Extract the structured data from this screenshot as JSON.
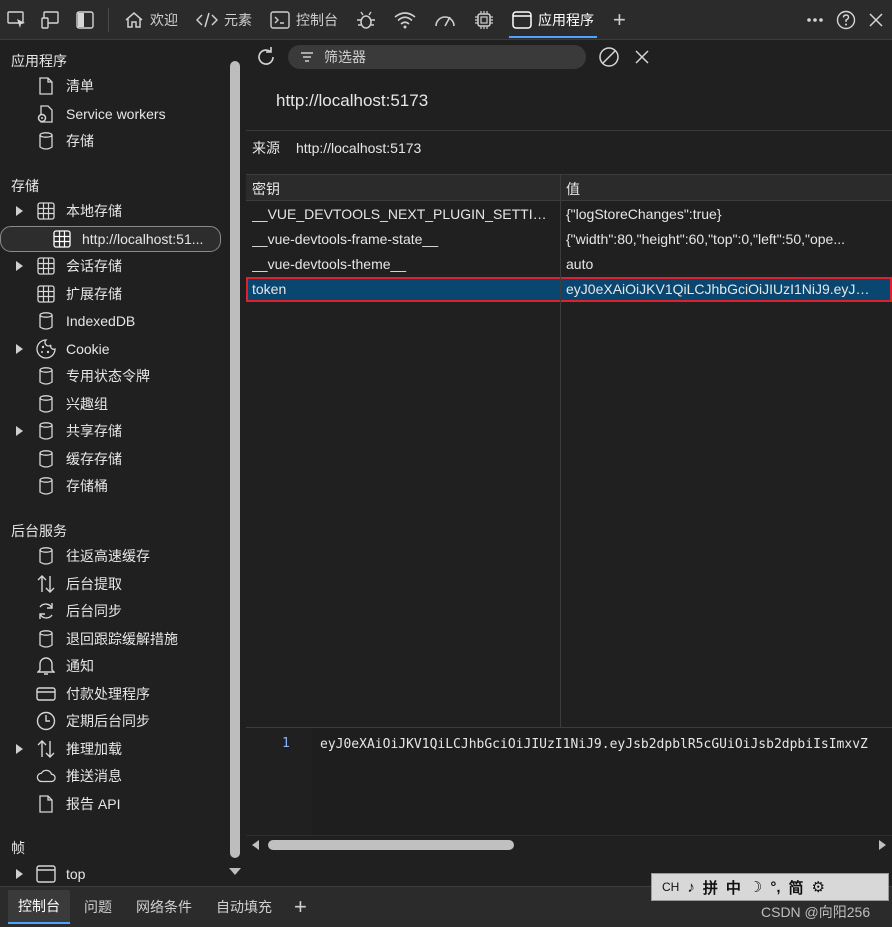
{
  "toolbar": {
    "tabs": [
      {
        "label": "欢迎",
        "icon": "home-icon"
      },
      {
        "label": "元素",
        "icon": "code-icon"
      },
      {
        "label": "控制台",
        "icon": "console-icon"
      },
      {
        "label": "",
        "icon": "bug-icon"
      },
      {
        "label": "",
        "icon": "wifi-icon"
      },
      {
        "label": "",
        "icon": "gauge-icon"
      },
      {
        "label": "",
        "icon": "chip-icon"
      },
      {
        "label": "应用程序",
        "icon": "app-window-icon"
      }
    ],
    "active_tab": "应用程序",
    "accent": "#4da3ff"
  },
  "sidebar": {
    "section_app": "应用程序",
    "app_items": [
      {
        "label": "清单",
        "icon": "file-icon"
      },
      {
        "label": "Service workers",
        "icon": "gear-file-icon"
      },
      {
        "label": "存储",
        "icon": "database-icon"
      }
    ],
    "section_storage": "存储",
    "storage_items": [
      {
        "label": "本地存储",
        "icon": "grid-icon",
        "expandable": true
      },
      {
        "label": "http://localhost:51...",
        "icon": "grid-icon",
        "selected": true
      },
      {
        "label": "会话存储",
        "icon": "grid-icon",
        "expandable": true
      },
      {
        "label": "扩展存储",
        "icon": "grid-icon"
      },
      {
        "label": "IndexedDB",
        "icon": "database-icon"
      },
      {
        "label": "Cookie",
        "icon": "cookie-icon",
        "expandable": true
      },
      {
        "label": "专用状态令牌",
        "icon": "database-icon"
      },
      {
        "label": "兴趣组",
        "icon": "database-icon"
      },
      {
        "label": "共享存储",
        "icon": "database-icon",
        "expandable": true
      },
      {
        "label": "缓存存储",
        "icon": "database-icon"
      },
      {
        "label": "存储桶",
        "icon": "database-icon"
      }
    ],
    "section_bg": "后台服务",
    "bg_items": [
      {
        "label": "往返高速缓存",
        "icon": "database-icon"
      },
      {
        "label": "后台提取",
        "icon": "updown-icon"
      },
      {
        "label": "后台同步",
        "icon": "sync-icon"
      },
      {
        "label": "退回跟踪缓解措施",
        "icon": "database-icon"
      },
      {
        "label": "通知",
        "icon": "bell-icon"
      },
      {
        "label": "付款处理程序",
        "icon": "card-icon"
      },
      {
        "label": "定期后台同步",
        "icon": "clock-icon"
      },
      {
        "label": "推理加载",
        "icon": "updown-icon",
        "expandable": true
      },
      {
        "label": "推送消息",
        "icon": "cloud-icon"
      },
      {
        "label": "报告 API",
        "icon": "file-icon"
      }
    ],
    "section_frames": "帧",
    "frame_items": [
      {
        "label": "top",
        "icon": "window-icon",
        "expandable": true
      }
    ]
  },
  "main": {
    "filter_placeholder": "筛选器",
    "origin_title": "http://localhost:5173",
    "origin_label": "来源",
    "origin_value": "http://localhost:5173",
    "columns": {
      "key": "密钥",
      "value": "值"
    },
    "rows": [
      {
        "key": "__VUE_DEVTOOLS_NEXT_PLUGIN_SETTINGS...",
        "value": "{\"logStoreChanges\":true}"
      },
      {
        "key": "__vue-devtools-frame-state__",
        "value": "{\"width\":80,\"height\":60,\"top\":0,\"left\":50,\"ope..."
      },
      {
        "key": "__vue-devtools-theme__",
        "value": "auto"
      },
      {
        "key": "token",
        "value": "eyJ0eXAiOiJKV1QiLCJhbGciOiJIUzI1NiJ9.eyJs...",
        "selected": true
      }
    ],
    "viewer_line_number": "1",
    "viewer_text": "eyJ0eXAiOiJKV1QiLCJhbGciOiJIUzI1NiJ9.eyJsb2dpblR5cGUiOiJsb2dpbiIsImxvZ",
    "selection_outline_color": "#e0202d",
    "selection_bg": "#094771"
  },
  "drawer": {
    "tabs": [
      "控制台",
      "问题",
      "网络条件",
      "自动填充"
    ],
    "active": "控制台"
  },
  "ime_bar": [
    "CH",
    "拼",
    "中",
    "简"
  ],
  "watermark": "CSDN @向阳256"
}
